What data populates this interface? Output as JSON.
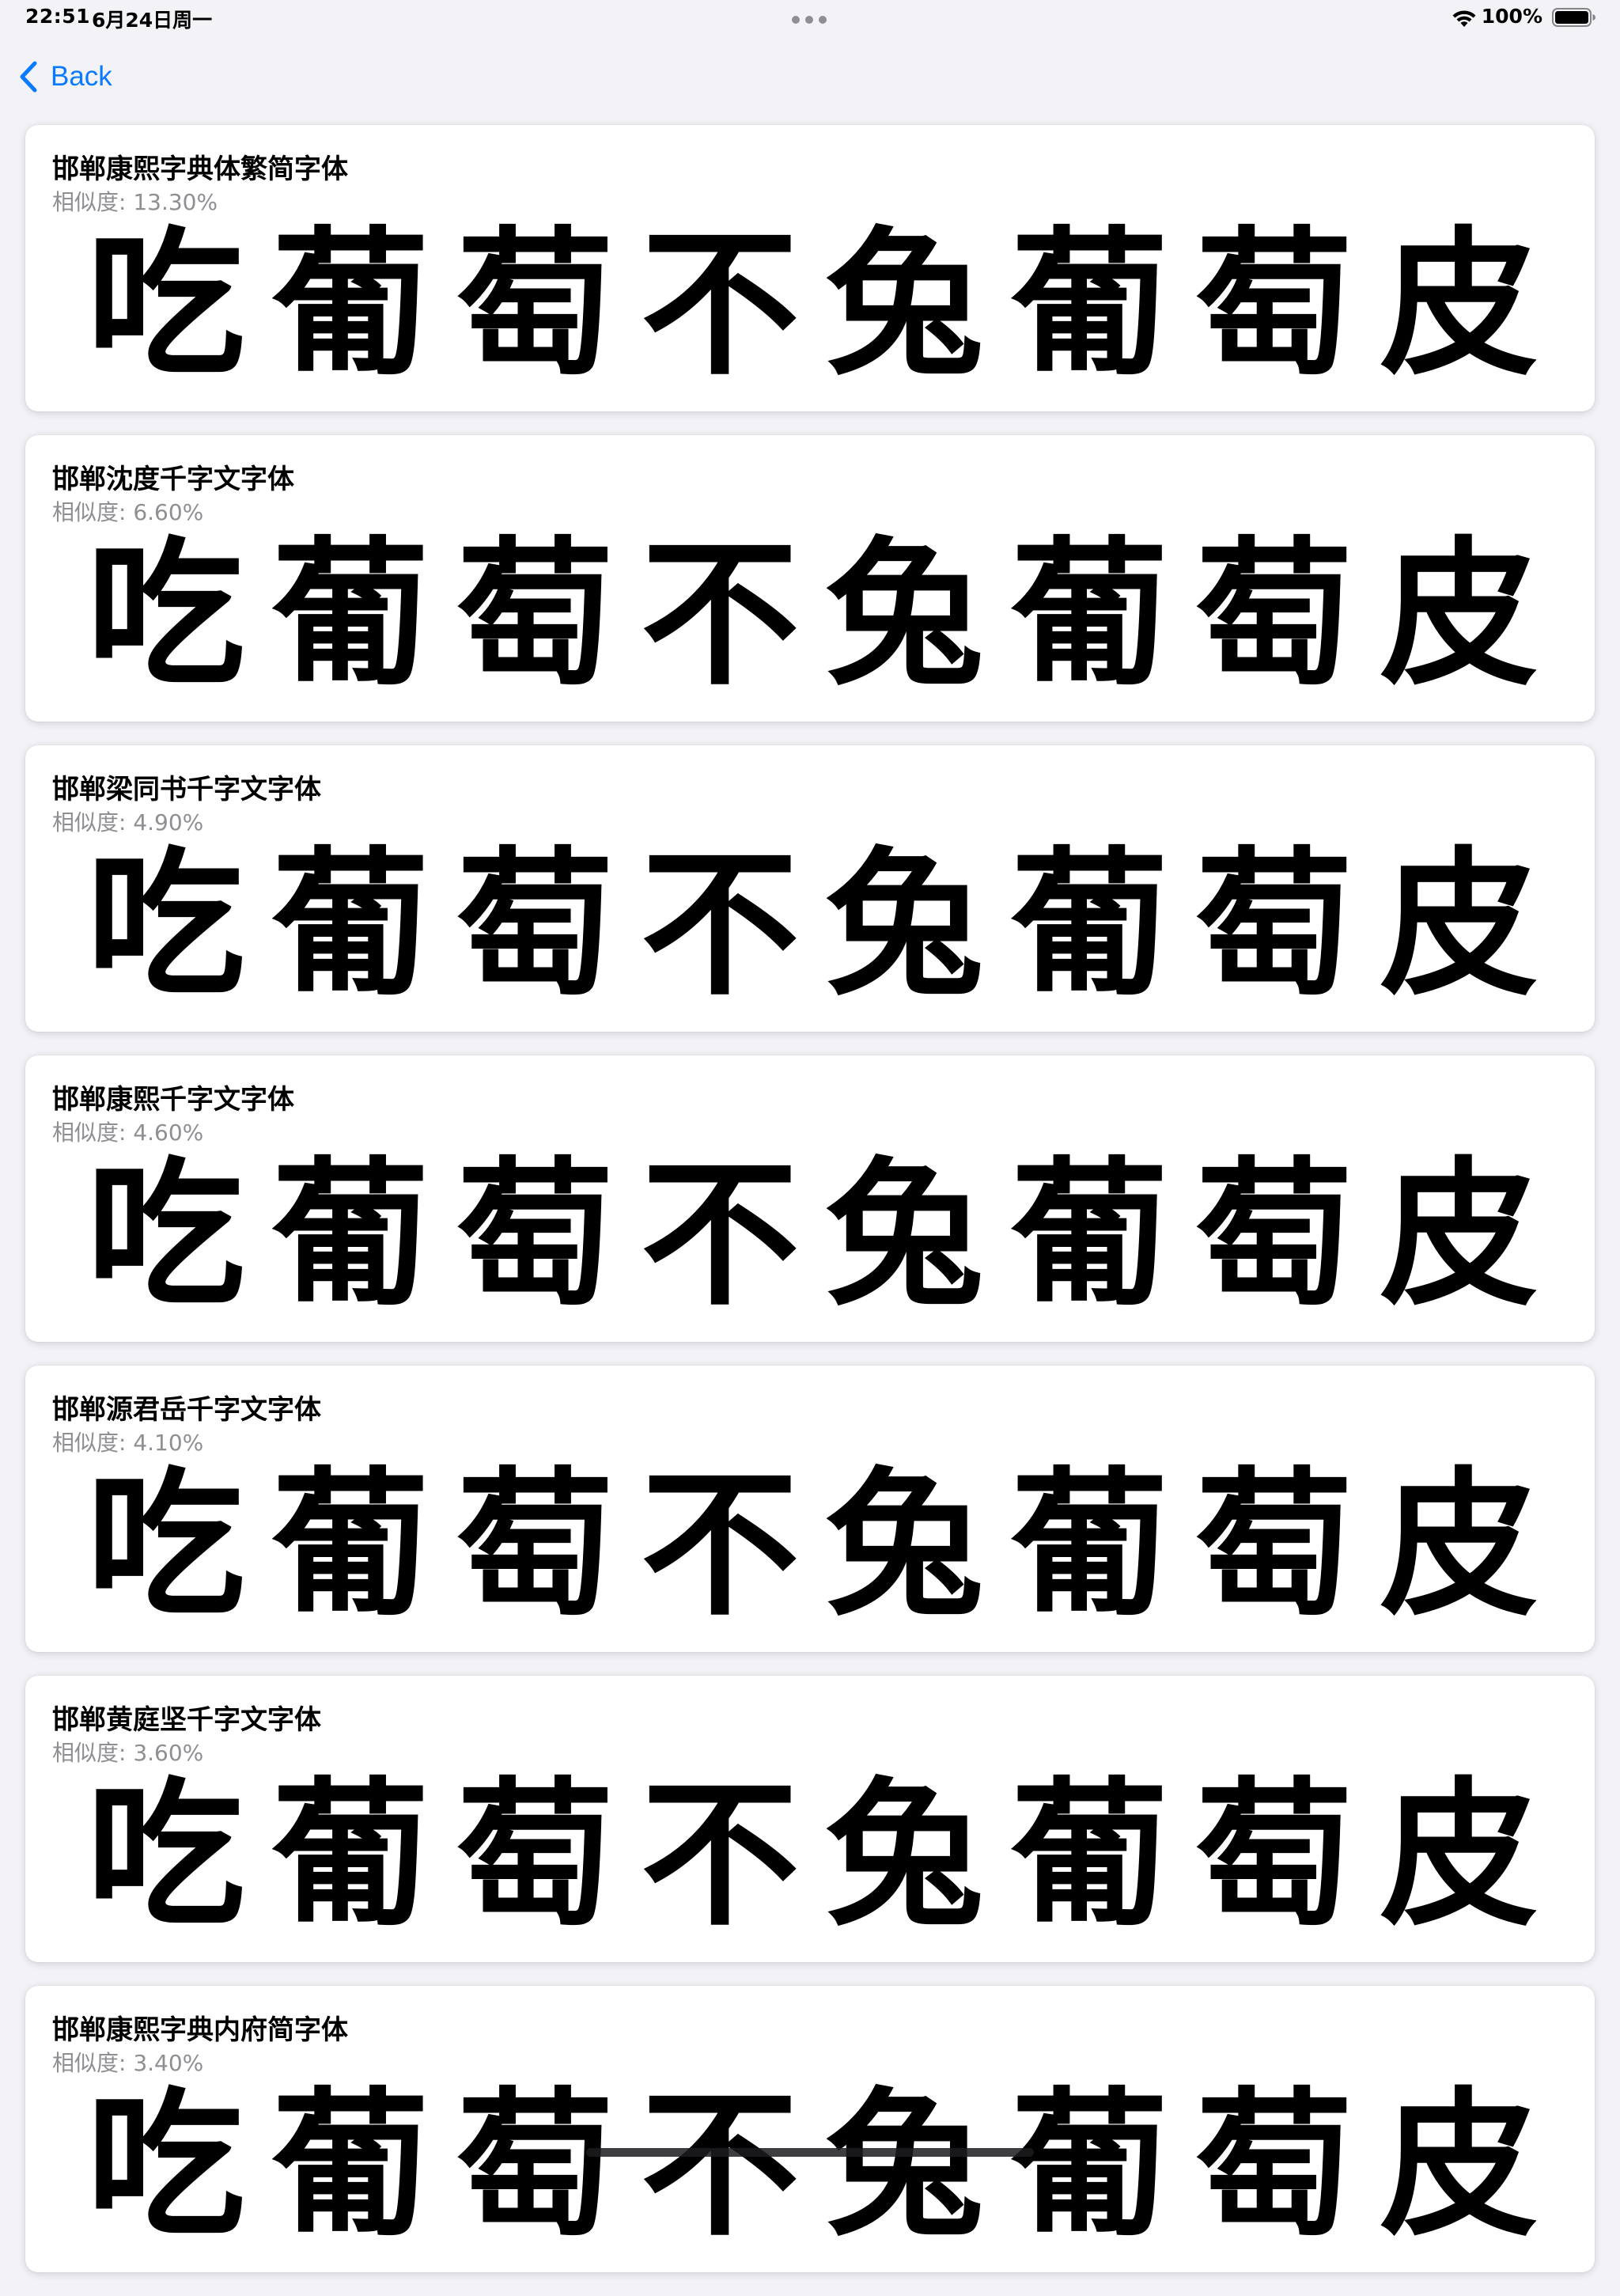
{
  "status_bar": {
    "time": "22:51",
    "date": "6月24日周一",
    "battery": "100%"
  },
  "nav": {
    "back_label": "Back"
  },
  "colors": {
    "accent": "#0a7aff",
    "secondary_text": "#8e8e93",
    "background": "#f2f2f7"
  },
  "sample_characters": [
    "吃",
    "葡",
    "萄",
    "不",
    "兔",
    "葡",
    "萄",
    "皮"
  ],
  "fonts": [
    {
      "name": "邯郸康熙字典体繁简字体",
      "similarity": "相似度: 13.30%"
    },
    {
      "name": "邯郸沈度千字文字体",
      "similarity": "相似度: 6.60%"
    },
    {
      "name": "邯郸梁同书千字文字体",
      "similarity": "相似度: 4.90%"
    },
    {
      "name": "邯郸康熙千字文字体",
      "similarity": "相似度: 4.60%"
    },
    {
      "name": "邯郸源君岳千字文字体",
      "similarity": "相似度: 4.10%"
    },
    {
      "name": "邯郸黄庭坚千字文字体",
      "similarity": "相似度: 3.60%"
    },
    {
      "name": "邯郸康熙字典内府简字体",
      "similarity": "相似度: 3.40%"
    }
  ]
}
